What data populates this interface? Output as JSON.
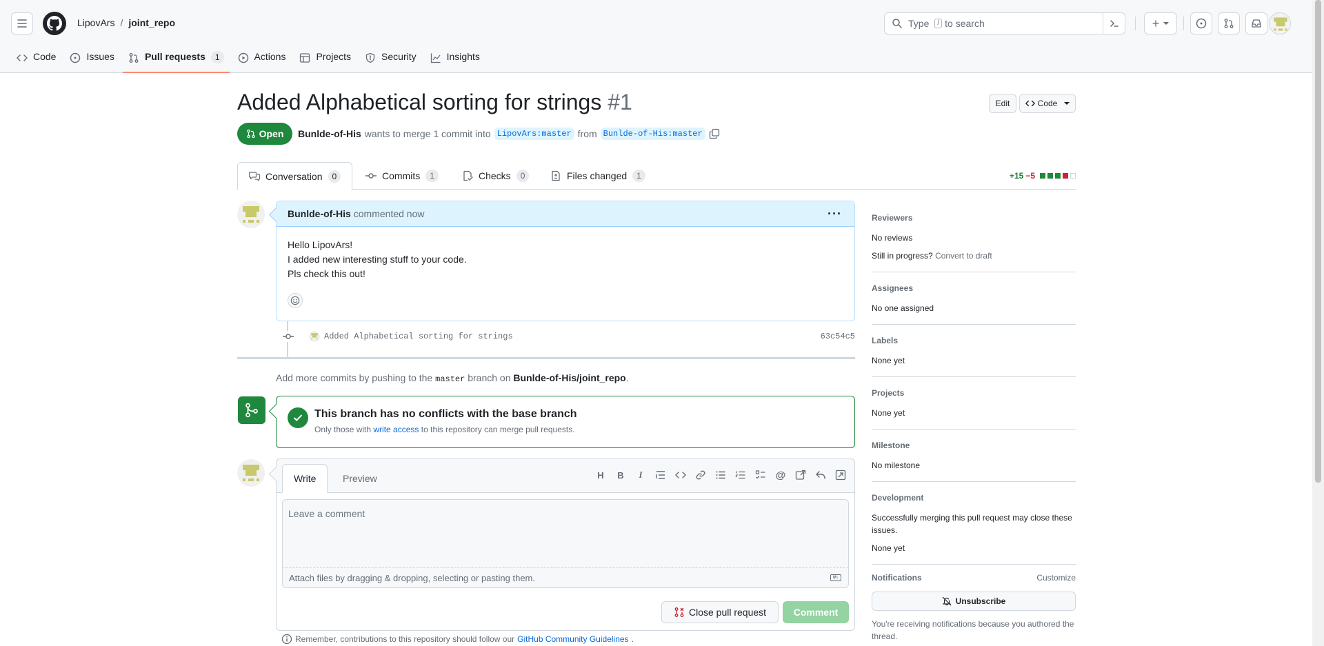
{
  "header": {
    "owner": "LipovArs",
    "separator": "/",
    "repo": "joint_repo",
    "search_placeholder": "Type",
    "search_slash": "/",
    "search_suffix": "to search",
    "plus_label": "+"
  },
  "repo_nav": [
    {
      "label": "Code",
      "icon": "code-icon"
    },
    {
      "label": "Issues",
      "icon": "issue-icon"
    },
    {
      "label": "Pull requests",
      "icon": "pull-request-icon",
      "count": "1",
      "active": true
    },
    {
      "label": "Actions",
      "icon": "play-icon"
    },
    {
      "label": "Projects",
      "icon": "table-icon"
    },
    {
      "label": "Security",
      "icon": "shield-icon"
    },
    {
      "label": "Insights",
      "icon": "graph-icon"
    }
  ],
  "pr": {
    "title": "Added Alphabetical sorting for strings",
    "number": "#1",
    "state": "Open",
    "author": "Bunlde-of-His",
    "meta_text": "wants to merge 1 commit into",
    "base_branch": "LipovArs:master",
    "from_text": "from",
    "head_branch": "Bunlde-of-His:master",
    "edit_label": "Edit",
    "code_label": "Code"
  },
  "tabs": [
    {
      "label": "Conversation",
      "count": "0",
      "icon": "comment-discussion-icon"
    },
    {
      "label": "Commits",
      "count": "1",
      "icon": "commit-icon"
    },
    {
      "label": "Checks",
      "count": "0",
      "icon": "checklist-icon"
    },
    {
      "label": "Files changed",
      "count": "1",
      "icon": "file-diff-icon"
    }
  ],
  "diffstat": {
    "additions": "+15",
    "deletions": "−5",
    "colors": [
      "#1f883d",
      "#1f883d",
      "#1f883d",
      "#cf222e",
      "#ffffff"
    ]
  },
  "comment": {
    "author": "Bunlde-of-His",
    "action": "commented now",
    "lines": [
      "Hello LipovArs!",
      "I added new interesting stuff to your code.",
      "Pls check this out!"
    ]
  },
  "commit": {
    "message": "Added Alphabetical sorting for strings",
    "sha": "63c54c5"
  },
  "push_hint": {
    "prefix": "Add more commits by pushing to the",
    "branch": "master",
    "middle": "branch on",
    "repo": "Bunlde-of-His/joint_repo",
    "suffix": "."
  },
  "merge": {
    "title": "This branch has no conflicts with the base branch",
    "sub_prefix": "Only those with",
    "sub_link": "write access",
    "sub_suffix": "to this repository can merge pull requests."
  },
  "new_comment": {
    "tab_write": "Write",
    "tab_preview": "Preview",
    "placeholder": "Leave a comment",
    "attach_text": "Attach files by dragging & dropping, selecting or pasting them.",
    "md_label": "M↓",
    "close_label": "Close pull request",
    "comment_label": "Comment"
  },
  "guidelines": {
    "prefix": "Remember, contributions to this repository should follow our",
    "link": "GitHub Community Guidelines",
    "suffix": "."
  },
  "sidebar": {
    "reviewers_head": "Reviewers",
    "reviewers_value": "No reviews",
    "draft_prefix": "Still in progress?",
    "draft_link": "Convert to draft",
    "assignees_head": "Assignees",
    "assignees_value": "No one assigned",
    "labels_head": "Labels",
    "labels_value": "None yet",
    "projects_head": "Projects",
    "projects_value": "None yet",
    "milestone_head": "Milestone",
    "milestone_value": "No milestone",
    "development_head": "Development",
    "development_text": "Successfully merging this pull request may close these issues.",
    "development_value": "None yet",
    "notifications_head": "Notifications",
    "customize": "Customize",
    "unsubscribe": "Unsubscribe",
    "notif_text": "You're receiving notifications because you authored the thread."
  }
}
